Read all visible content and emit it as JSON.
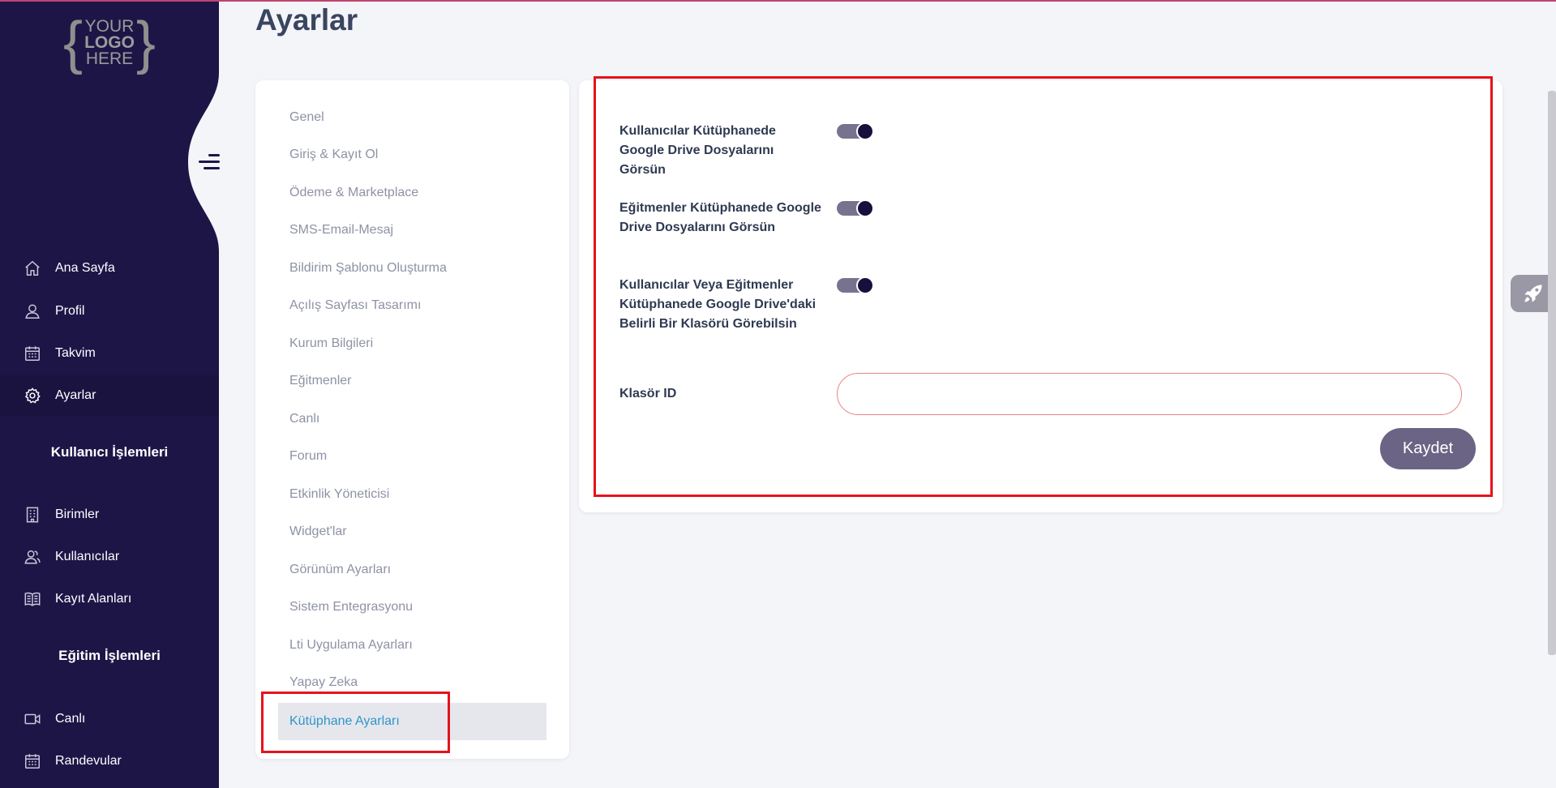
{
  "page": {
    "title": "Ayarlar"
  },
  "logo": {
    "line1": "YOUR",
    "line2": "LOGO",
    "line3": "HERE"
  },
  "sidebar": {
    "items": [
      {
        "label": "Ana Sayfa",
        "icon": "home-icon"
      },
      {
        "label": "Profil",
        "icon": "user-icon"
      },
      {
        "label": "Takvim",
        "icon": "calendar-icon"
      },
      {
        "label": "Ayarlar",
        "icon": "gear-icon",
        "active": true
      }
    ],
    "section_user": "Kullanıcı İşlemleri",
    "user_items": [
      {
        "label": "Birimler",
        "icon": "building-icon"
      },
      {
        "label": "Kullanıcılar",
        "icon": "users-icon"
      },
      {
        "label": "Kayıt Alanları",
        "icon": "book-icon"
      }
    ],
    "section_education": "Eğitim İşlemleri",
    "education_items": [
      {
        "label": "Canlı",
        "icon": "video-icon"
      },
      {
        "label": "Randevular",
        "icon": "calendar-icon"
      }
    ]
  },
  "settings_menu": {
    "items": [
      "Genel",
      "Giriş & Kayıt Ol",
      "Ödeme & Marketplace",
      "SMS-Email-Mesaj",
      "Bildirim Şablonu Oluşturma",
      "Açılış Sayfası Tasarımı",
      "Kurum Bilgileri",
      "Eğitmenler",
      "Canlı",
      "Forum",
      "Etkinlik Yöneticisi",
      "Widget'lar",
      "Görünüm Ayarları",
      "Sistem Entegrasyonu",
      "Lti Uygulama Ayarları",
      "Yapay Zeka",
      "Kütüphane Ayarları"
    ],
    "active_index": 16
  },
  "library_settings": {
    "toggle1_label": "Kullanıcılar Kütüphanede Google Drive Dosyalarını Görsün",
    "toggle1_on": true,
    "toggle2_label": "Eğitmenler Kütüphanede Google Drive Dosyalarını Görsün",
    "toggle2_on": true,
    "toggle3_label": "Kullanıcılar Veya Eğitmenler Kütüphanede Google Drive'daki Belirli Bir Klasörü Görebilsin",
    "toggle3_on": true,
    "folder_label": "Klasör ID",
    "folder_value": "",
    "save_label": "Kaydet"
  },
  "colors": {
    "sidebar_bg": "#1e1547",
    "accent_active": "#2f95c9",
    "toggle_knob": "#16103d",
    "save_button": "#6c6484",
    "highlight": "#e5131a"
  }
}
